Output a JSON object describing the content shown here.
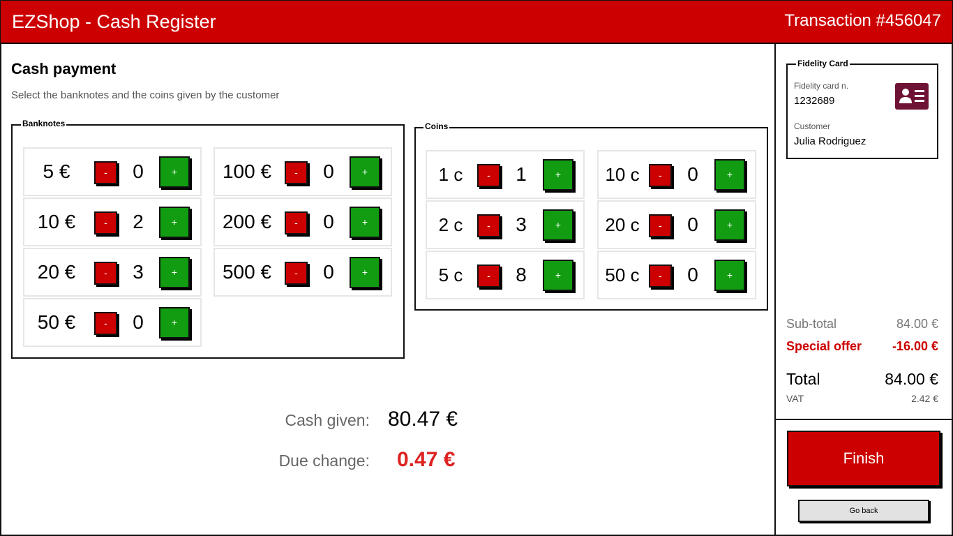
{
  "header": {
    "title": "EZShop - Cash Register",
    "transaction": "Transaction #456047"
  },
  "page": {
    "title": "Cash payment",
    "subtitle": "Select the banknotes and the coins given by the customer"
  },
  "banknotes": {
    "legend": "Banknotes",
    "minus_label": "-",
    "plus_label": "+",
    "items": [
      {
        "label": "5 €",
        "qty": "0"
      },
      {
        "label": "10 €",
        "qty": "2"
      },
      {
        "label": "20 €",
        "qty": "3"
      },
      {
        "label": "50 €",
        "qty": "0"
      },
      {
        "label": "100 €",
        "qty": "0"
      },
      {
        "label": "200 €",
        "qty": "0"
      },
      {
        "label": "500 €",
        "qty": "0"
      }
    ]
  },
  "coins": {
    "legend": "Coins",
    "minus_label": "-",
    "plus_label": "+",
    "items": [
      {
        "label": "1 c",
        "qty": "1"
      },
      {
        "label": "2 c",
        "qty": "3"
      },
      {
        "label": "5 c",
        "qty": "8"
      },
      {
        "label": "10 c",
        "qty": "0"
      },
      {
        "label": "20 c",
        "qty": "0"
      },
      {
        "label": "50 c",
        "qty": "0"
      }
    ]
  },
  "summary": {
    "cash_given_label": "Cash given:",
    "cash_given_value": "80.47 €",
    "due_change_label": "Due change:",
    "due_change_value": "0.47 €"
  },
  "fidelity": {
    "legend": "Fidelity Card",
    "card_label": "Fidelity card n.",
    "card_number": "1232689",
    "customer_label": "Customer",
    "customer_name": "Julia Rodriguez"
  },
  "totals": {
    "subtotal_label": "Sub-total",
    "subtotal_value": "84.00 €",
    "offer_label": "Special offer",
    "offer_value": "-16.00 €",
    "total_label": "Total",
    "total_value": "84.00 €",
    "vat_label": "VAT",
    "vat_value": "2.42 €"
  },
  "actions": {
    "finish": "Finish",
    "go_back": "Go back"
  },
  "colors": {
    "brand_red": "#cc0000",
    "plus_green": "#119c11",
    "card_icon": "#6e1336",
    "change_red": "#dd2222"
  }
}
